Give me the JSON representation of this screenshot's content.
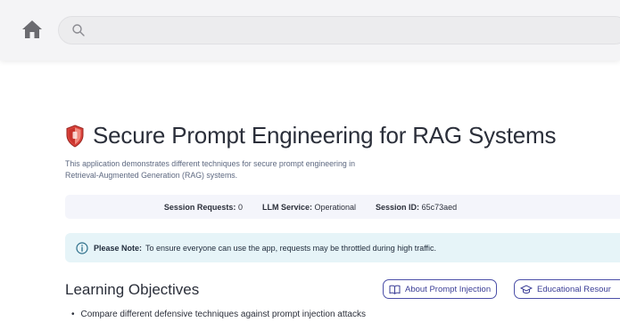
{
  "header": {
    "home_icon": "home-icon",
    "search": {
      "placeholder": "",
      "icon": "search-icon"
    }
  },
  "page": {
    "title_icon": "shield-icon",
    "title": "Secure Prompt Engineering for RAG Systems",
    "description_line1": "This application demonstrates different techniques for secure prompt engineering in",
    "description_line2": "Retrieval-Augmented Generation (RAG) systems."
  },
  "status": {
    "session_requests_label": "Session Requests:",
    "session_requests_value": "0",
    "llm_service_label": "LLM Service:",
    "llm_service_value": "Operational",
    "session_id_label": "Session ID:",
    "session_id_value": "65c73aed"
  },
  "note": {
    "icon": "info-icon",
    "label": "Please Note:",
    "text": "To ensure everyone can use the app, requests may be throttled during high traffic."
  },
  "learning": {
    "title": "Learning Objectives",
    "buttons": [
      {
        "label": "About Prompt Injection",
        "icon": "book-icon"
      },
      {
        "label": "Educational Resour",
        "icon": "graduation-cap-icon"
      }
    ],
    "objectives": [
      "Compare different defensive techniques against prompt injection attacks"
    ]
  },
  "colors": {
    "accent": "#3a3d96",
    "header_bg": "#f4f4f6",
    "note_bg": "#e6f4f8",
    "status_bg": "#f4f5fb",
    "shield_red": "#d9413a"
  }
}
